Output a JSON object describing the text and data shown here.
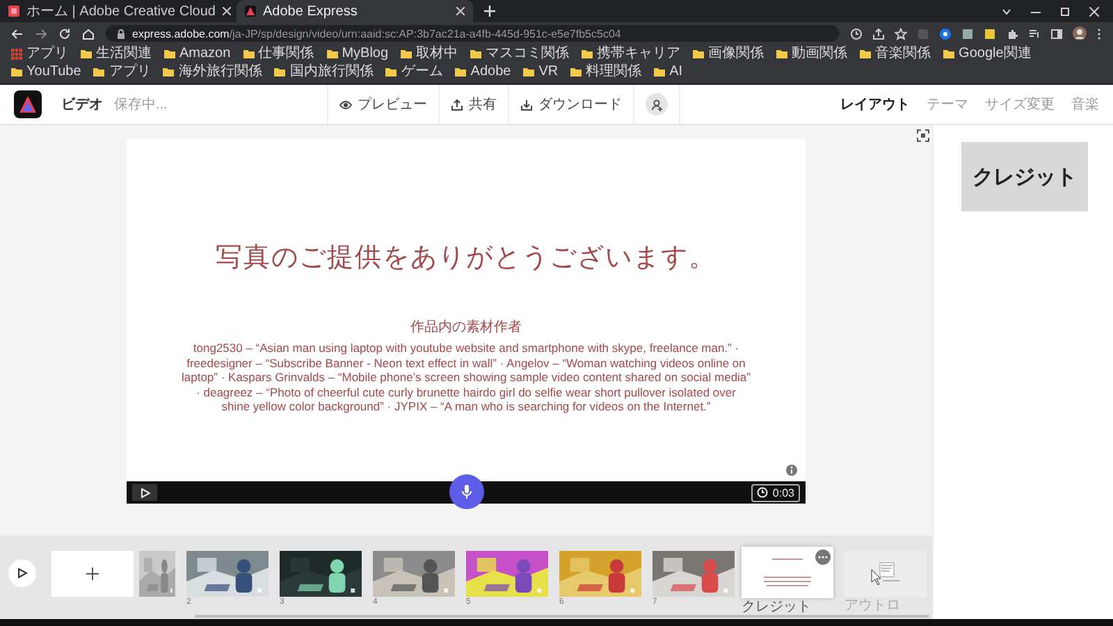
{
  "browser": {
    "tabs": [
      {
        "title": "ホーム | Adobe Creative Cloud",
        "selected": false
      },
      {
        "title": "Adobe Express",
        "selected": true
      }
    ],
    "address": {
      "domain": "express.adobe.com",
      "path": "/ja-JP/sp/design/video/urn:aaid:sc:AP:3b7ac21a-a4fb-445d-951c-e5e7fb5c5c04"
    },
    "bookmarks": [
      {
        "label": "アプリ",
        "kind": "apps"
      },
      {
        "label": "生活関連",
        "kind": "folder"
      },
      {
        "label": "Amazon",
        "kind": "folder"
      },
      {
        "label": "仕事関係",
        "kind": "folder"
      },
      {
        "label": "MyBlog",
        "kind": "folder"
      },
      {
        "label": "取材中",
        "kind": "folder"
      },
      {
        "label": "マスコミ関係",
        "kind": "folder"
      },
      {
        "label": "携帯キャリア",
        "kind": "folder"
      },
      {
        "label": "画像関係",
        "kind": "folder"
      },
      {
        "label": "動画関係",
        "kind": "folder"
      },
      {
        "label": "音楽関係",
        "kind": "folder"
      },
      {
        "label": "Google関連",
        "kind": "folder"
      },
      {
        "label": "YouTube",
        "kind": "folder"
      },
      {
        "label": "アプリ",
        "kind": "folder"
      },
      {
        "label": "海外旅行関係",
        "kind": "folder"
      },
      {
        "label": "国内旅行関係",
        "kind": "folder"
      },
      {
        "label": "ゲーム",
        "kind": "folder"
      },
      {
        "label": "Adobe",
        "kind": "folder"
      },
      {
        "label": "VR",
        "kind": "folder"
      },
      {
        "label": "料理関係",
        "kind": "folder"
      },
      {
        "label": "AI",
        "kind": "folder"
      }
    ]
  },
  "header": {
    "title": "ビデオ",
    "status": "保存中...",
    "actions": [
      {
        "label": "プレビュー",
        "kind": "preview"
      },
      {
        "label": "共有",
        "kind": "share"
      },
      {
        "label": "ダウンロード",
        "kind": "download"
      }
    ],
    "panel_tabs": [
      {
        "label": "レイアウト",
        "selected": true
      },
      {
        "label": "テーマ",
        "selected": false
      },
      {
        "label": "サイズ変更",
        "selected": false
      },
      {
        "label": "音楽",
        "selected": false
      }
    ]
  },
  "slide": {
    "title": "写真のご提供をありがとうございます。",
    "subtitle": "作品内の素材作者",
    "credits": "tong2530 – “Asian man using laptop with youtube website and smartphone with skype, freelance man.” · freedesigner – “Subscribe Banner - Neon text effect in wall” · Angelov – “Woman watching videos online on laptop” · Kaspars Grinvalds – “Mobile phone’s screen showing sample video content shared on social media” · deagreez – “Photo of cheerful cute curly brunette hairdo girl do selfie wear short pullover isolated over shine yellow color background” · JYPIX – “A man who is searching for videos on the Internet.”",
    "duration": "0:03"
  },
  "layout_panel": {
    "options": [
      {
        "label": "クレジット",
        "selected": true
      }
    ]
  },
  "timeline": {
    "clips": [
      {
        "kind": "add"
      },
      {
        "kind": "partial"
      },
      {
        "number": "2",
        "selected": false
      },
      {
        "number": "3",
        "selected": false
      },
      {
        "number": "4",
        "selected": false
      },
      {
        "number": "5",
        "selected": false
      },
      {
        "number": "6",
        "selected": false
      },
      {
        "number": "7",
        "selected": false
      },
      {
        "kind": "credits",
        "label": "クレジット",
        "selected": true
      },
      {
        "kind": "outro",
        "label": "アウトロ",
        "selected": false
      }
    ]
  }
}
